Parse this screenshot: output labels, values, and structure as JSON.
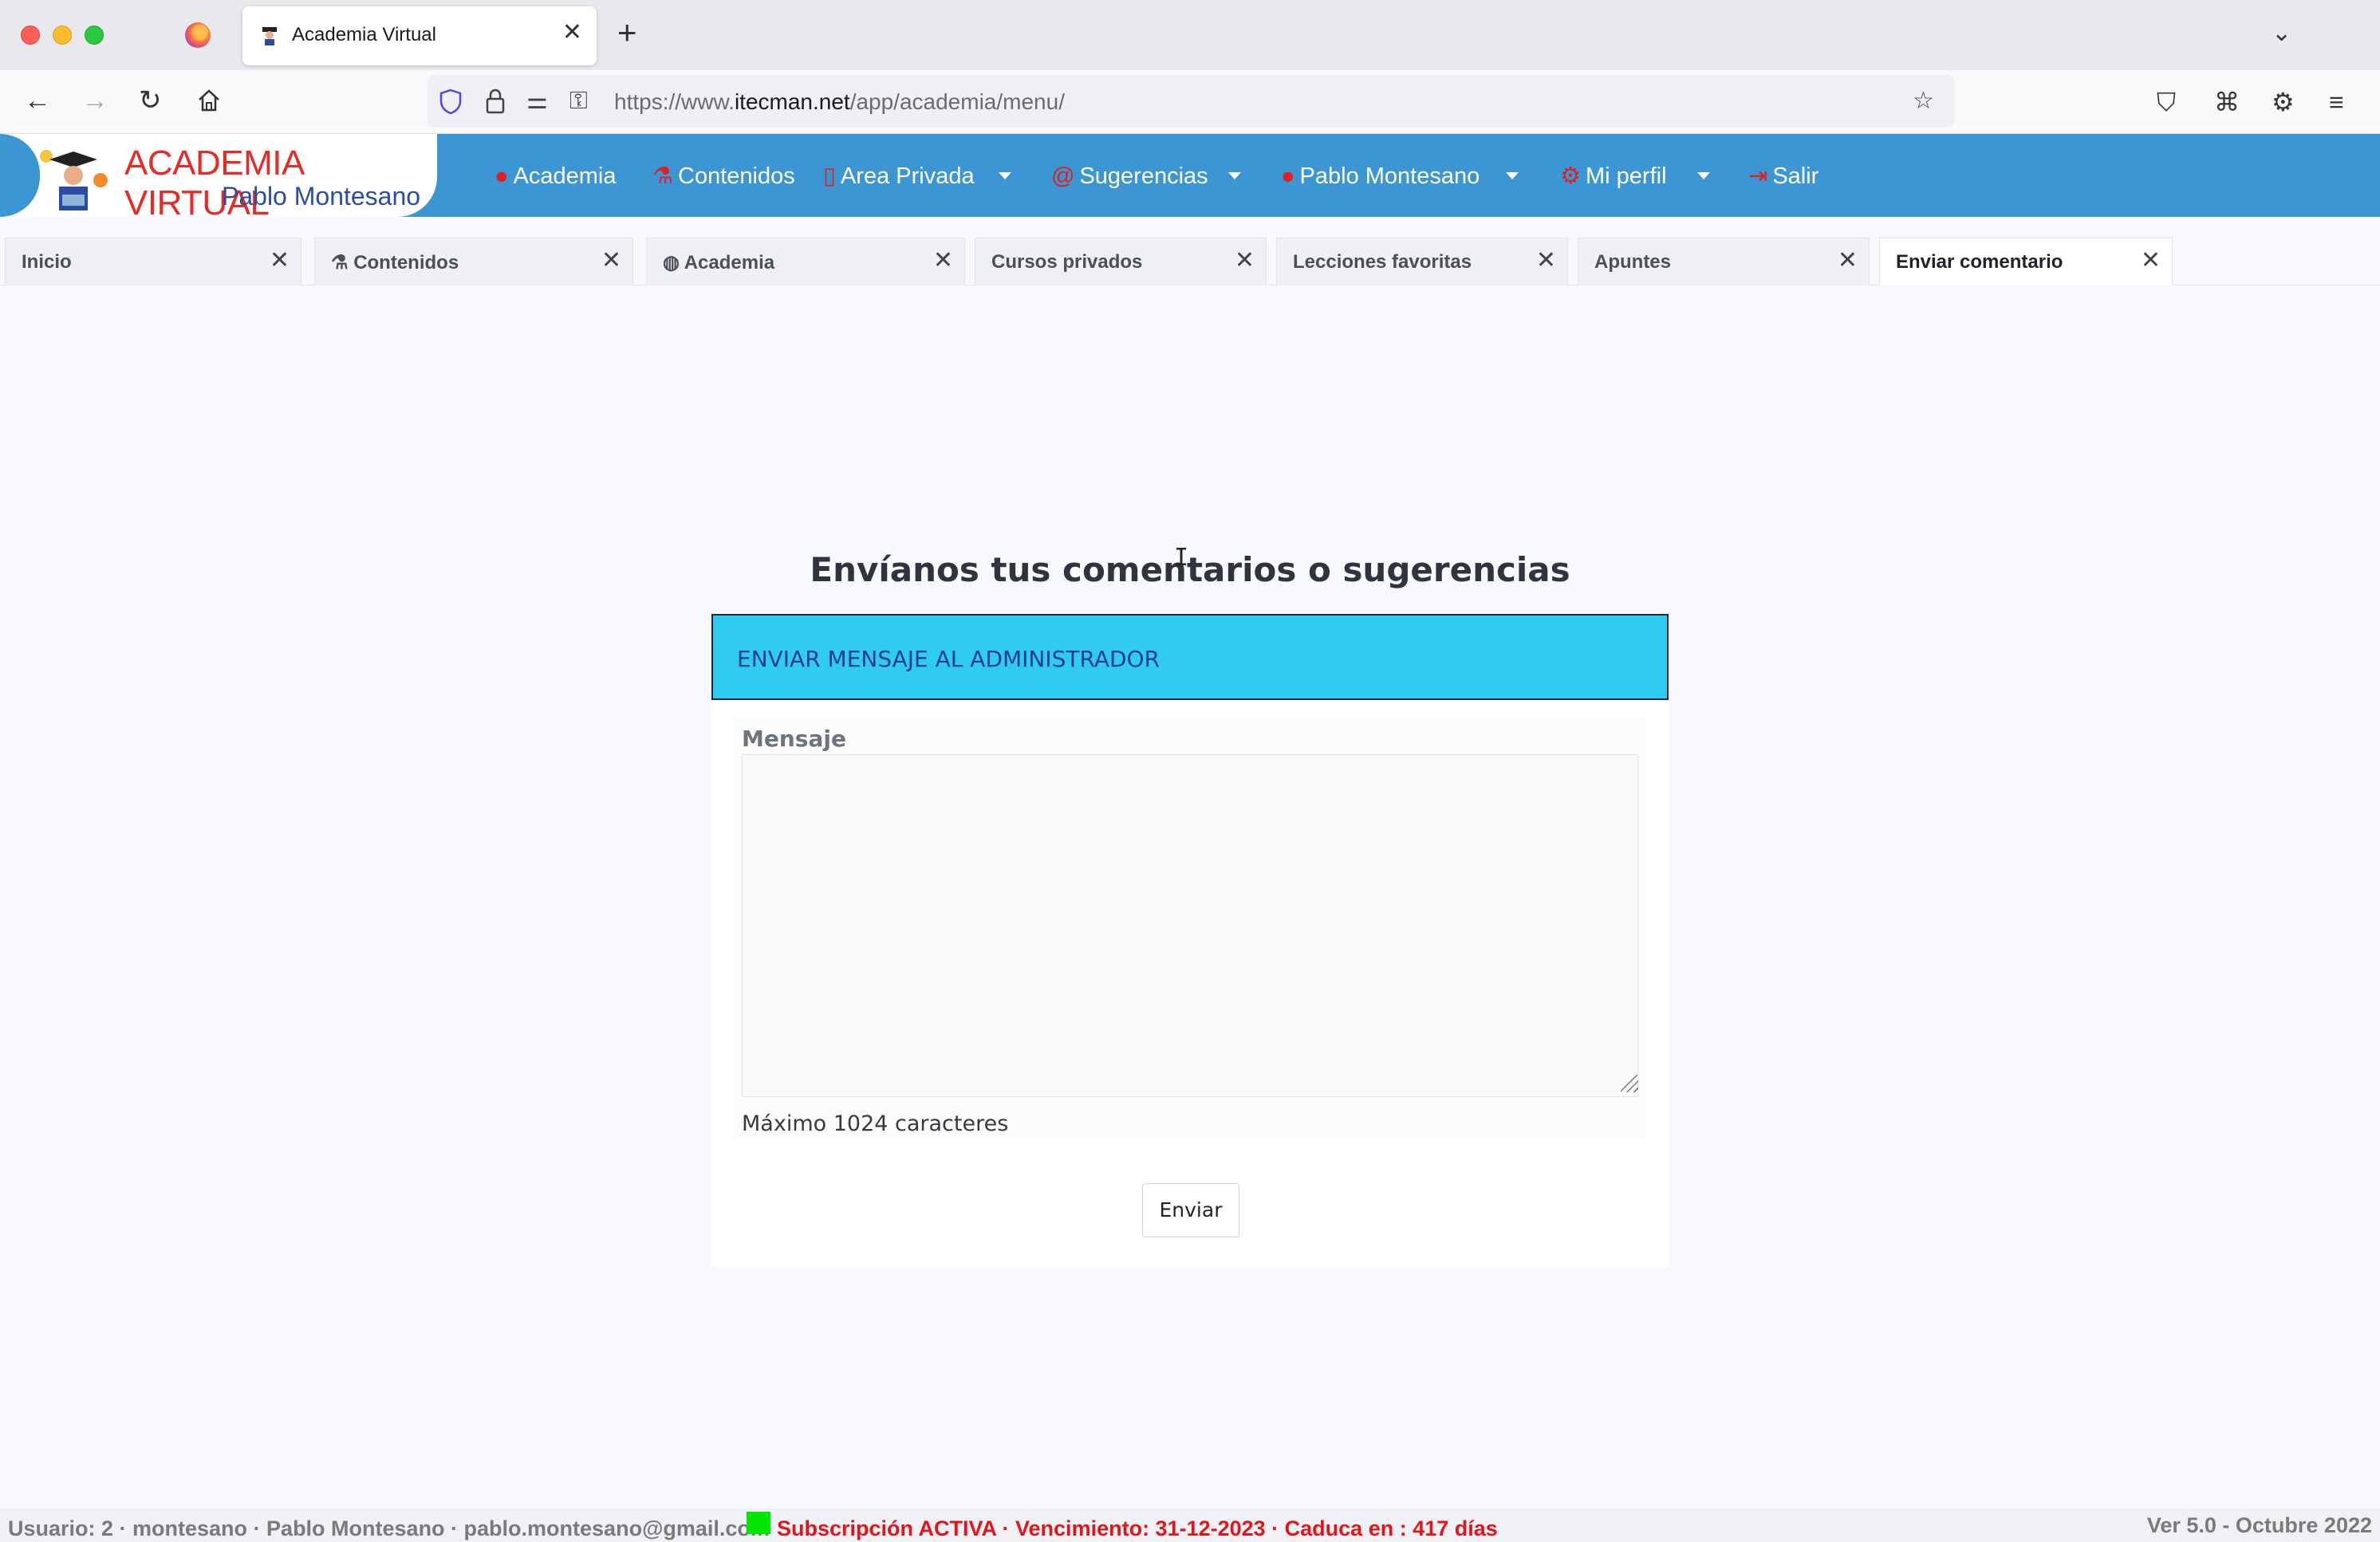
{
  "browser": {
    "tab_title": "Academia Virtual",
    "new_tab_icon": "plus-icon",
    "url_prefix": "https://www.",
    "url_domain": "itecman.net",
    "url_path": "/app/academia/menu/"
  },
  "app": {
    "logo_title": "ACADEMIA VIRTUAL",
    "logo_subtitle": "Pablo Montesano",
    "menu": [
      {
        "label": "Academia",
        "icon": "globe-icon"
      },
      {
        "label": "Contenidos",
        "icon": "flask-icon"
      },
      {
        "label": "Area Privada",
        "icon": "bookmark-icon"
      },
      {
        "label": "Sugerencias",
        "icon": "at-icon"
      },
      {
        "label": "Pablo Montesano",
        "icon": "user-icon"
      },
      {
        "label": "Mi perfil",
        "icon": "gears-icon"
      },
      {
        "label": "Salir",
        "icon": "sign-out-icon"
      }
    ],
    "tabs": [
      {
        "label": "Inicio"
      },
      {
        "label": "Contenidos"
      },
      {
        "label": "Academia"
      },
      {
        "label": "Cursos privados"
      },
      {
        "label": "Lecciones favoritas"
      },
      {
        "label": "Apuntes"
      },
      {
        "label": "Enviar comentario"
      }
    ]
  },
  "content": {
    "heading": "Envíanos tus comentarios o sugerencias",
    "card_header": "ENVIAR MENSAJE AL ADMINISTRADOR",
    "field_label": "Mensaje",
    "field_value": "",
    "field_help": "Máximo 1024 caracteres",
    "submit_label": "Enviar"
  },
  "footer": {
    "user_info": "Usuario: 2 · montesano · Pablo Montesano · pablo.montesano@gmail.com",
    "subscription": "Subscripción ACTIVA · Vencimiento: 31-12-2023 · Caduca en : 417 días",
    "status_color": "#00e600",
    "version": "Ver 5.0 - Octubre 2022"
  }
}
